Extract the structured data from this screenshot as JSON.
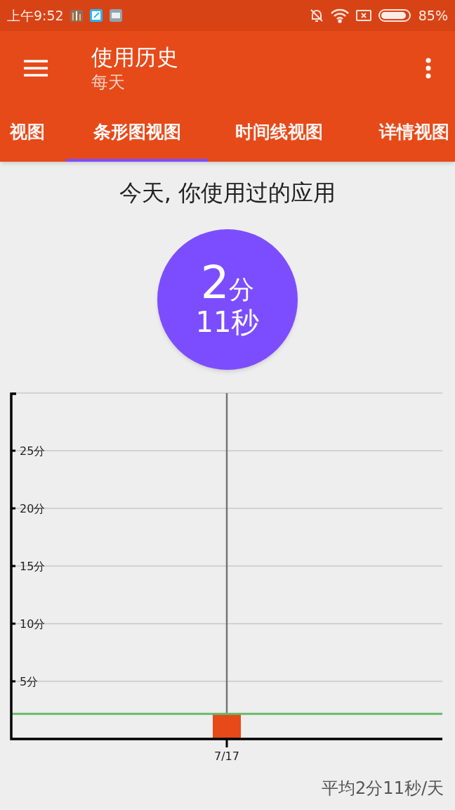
{
  "status_bar": {
    "time": "上午9:52",
    "battery": "85%"
  },
  "toolbar": {
    "title": "使用历史",
    "subtitle": "每天"
  },
  "tabs": [
    {
      "label": "视图",
      "selected": false
    },
    {
      "label": "条形图视图",
      "selected": true
    },
    {
      "label": "时间线视图",
      "selected": false
    },
    {
      "label": "详情视图",
      "selected": false
    }
  ],
  "heading": "今天, 你使用过的应用",
  "total": {
    "minutes": "2",
    "minute_unit": "分",
    "seconds": "11秒"
  },
  "chart_data": {
    "type": "bar",
    "categories": [
      "7/17"
    ],
    "values": [
      2.18
    ],
    "ylim": [
      0,
      30
    ],
    "yticks": [
      {
        "value": 5,
        "label": "5分"
      },
      {
        "value": 10,
        "label": "10分"
      },
      {
        "value": 15,
        "label": "15分"
      },
      {
        "value": 20,
        "label": "20分"
      },
      {
        "value": 25,
        "label": "25分"
      }
    ],
    "grid": true,
    "ref_lines": [
      {
        "axis": "y",
        "value": 2.18,
        "color": "#66bb6a"
      },
      {
        "axis": "x",
        "value": "7/17",
        "color": "#757575"
      }
    ]
  },
  "average": "平均2分11秒/天"
}
